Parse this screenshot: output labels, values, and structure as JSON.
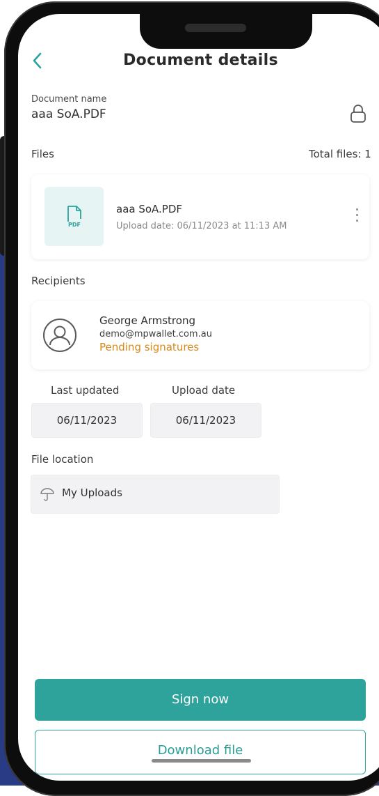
{
  "header": {
    "title": "Document details",
    "back_icon": "chevron-left-icon"
  },
  "document": {
    "name_label": "Document name",
    "name_value": "aaa SoA.PDF",
    "lock_icon": "lock-icon"
  },
  "files": {
    "label": "Files",
    "total": "Total files: 1",
    "items": [
      {
        "name": "aaa SoA.PDF",
        "upload_date": "Upload date: 06/11/2023 at 11:13 AM",
        "icon": "pdf-file-icon",
        "icon_text": "PDF"
      }
    ]
  },
  "recipients": {
    "label": "Recipients",
    "items": [
      {
        "name": "George Armstrong",
        "email": "demo@mpwallet.com.au",
        "status": "Pending signatures"
      }
    ]
  },
  "dates": {
    "last_updated_label": "Last updated",
    "last_updated_value": "06/11/2023",
    "upload_date_label": "Upload date",
    "upload_date_value": "06/11/2023"
  },
  "location": {
    "label": "File location",
    "value": "My Uploads",
    "icon": "umbrella-icon"
  },
  "actions": {
    "sign_label": "Sign now",
    "download_label": "Download file"
  },
  "colors": {
    "accent": "#2ea39c",
    "pending": "#d98a1a",
    "background_blue": "#2a3b86"
  }
}
